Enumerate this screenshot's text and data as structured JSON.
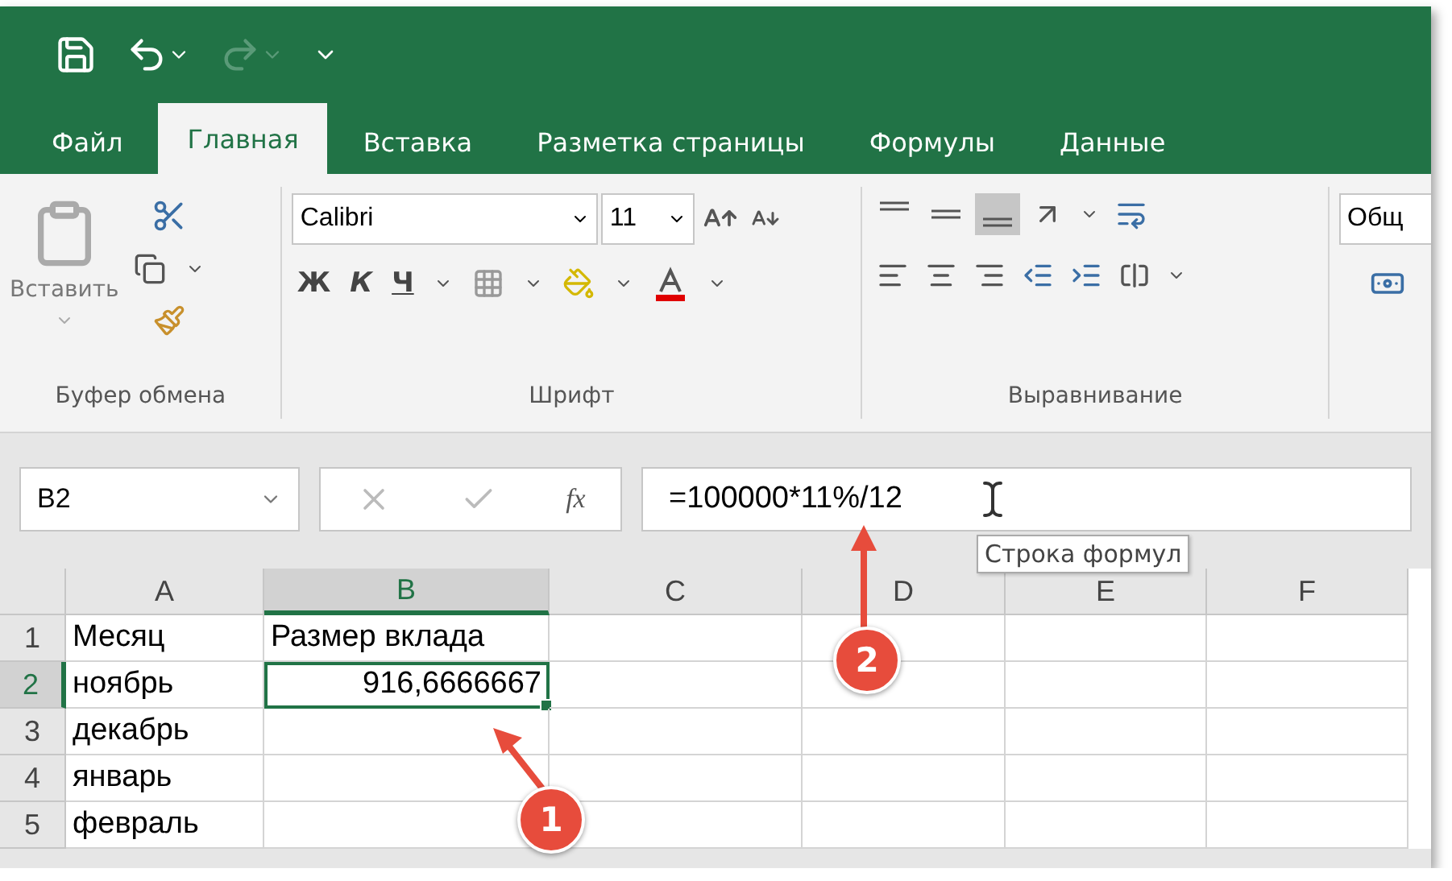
{
  "quick_access": [
    {
      "kind": "save",
      "disabled": false
    },
    {
      "kind": "undo",
      "disabled": false
    },
    {
      "kind": "redo",
      "disabled": true
    },
    {
      "kind": "customize",
      "disabled": false
    }
  ],
  "tabs": [
    {
      "label": "Файл",
      "selected": false
    },
    {
      "label": "Главная",
      "selected": true
    },
    {
      "label": "Вставка",
      "selected": false
    },
    {
      "label": "Разметка страницы",
      "selected": false
    },
    {
      "label": "Формулы",
      "selected": false
    },
    {
      "label": "Данные",
      "selected": false
    }
  ],
  "ribbon": {
    "clipboard": {
      "paste_label": "Вставить",
      "group_label": "Буфер обмена"
    },
    "font": {
      "font_name": "Calibri",
      "font_size": "11",
      "bold_key": "Ж",
      "italic_key": "К",
      "underline_key": "Ч",
      "group_label": "Шрифт"
    },
    "alignment": {
      "bottom_align_selected": true,
      "group_label": "Выравнивание"
    },
    "number": {
      "format": "Общ"
    }
  },
  "formula_bar": {
    "name_box": "B2",
    "function_key": "fx",
    "formula": "=100000*11%/12",
    "tooltip": "Строка формул"
  },
  "sheet": {
    "columns": [
      {
        "label": "A",
        "selected": false
      },
      {
        "label": "B",
        "selected": true
      },
      {
        "label": "C",
        "selected": false
      },
      {
        "label": "D",
        "selected": false
      },
      {
        "label": "E",
        "selected": false
      },
      {
        "label": "F",
        "selected": false
      }
    ],
    "rows": [
      {
        "label": "1",
        "selected": false,
        "cells": [
          {
            "text": "Месяц",
            "kind": "text",
            "selected": false
          },
          {
            "text": "Размер вклада",
            "kind": "text",
            "selected": false
          }
        ]
      },
      {
        "label": "2",
        "selected": true,
        "cells": [
          {
            "text": "ноябрь",
            "kind": "text",
            "selected": false
          },
          {
            "text": "916,6666667",
            "kind": "number",
            "selected": true
          }
        ]
      },
      {
        "label": "3",
        "selected": false,
        "cells": [
          {
            "text": "декабрь",
            "kind": "text",
            "selected": false
          }
        ]
      },
      {
        "label": "4",
        "selected": false,
        "cells": [
          {
            "text": "январь",
            "kind": "text",
            "selected": false
          }
        ]
      },
      {
        "label": "5",
        "selected": false,
        "cells": [
          {
            "text": "февраль",
            "kind": "text",
            "selected": false
          }
        ]
      }
    ]
  },
  "callouts": [
    {
      "label": "1"
    },
    {
      "label": "2"
    }
  ]
}
